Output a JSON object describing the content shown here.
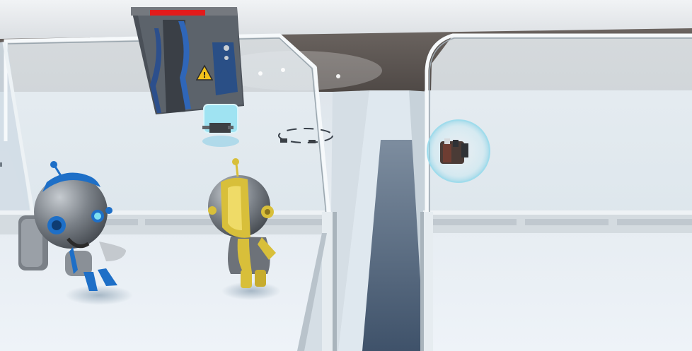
{
  "scene": {
    "colors": {
      "sky": "#e4e8ec",
      "back_wall": "#5a5450",
      "floor": "#e7eff5",
      "glass": "#d7e3ea",
      "rail": "#c5cdd3",
      "frame": "#eef3f6",
      "chasm": "#4e6277",
      "door_blue": "#2c4f8c",
      "door_gray": "#5b6168",
      "door_health": "#e21b1b",
      "robot_blue": "#1e6fc7",
      "robot_gold": "#d8bf3a",
      "robot_gray": "#6d7279",
      "bubble": "#9fdcec"
    },
    "door": {
      "icon": "warning-icon",
      "health": 1.0
    },
    "characters": [
      {
        "name": "blue-robot",
        "icon": "blue-robot-icon"
      },
      {
        "name": "yellow-robot",
        "icon": "yellow-robot-icon"
      }
    ],
    "pickups": [
      {
        "name": "drone-pickup",
        "icon": "drone-icon"
      },
      {
        "name": "backpack-pickup",
        "icon": "backpack-icon"
      },
      {
        "name": "ring-marker",
        "icon": "ring-marker-icon"
      }
    ]
  }
}
